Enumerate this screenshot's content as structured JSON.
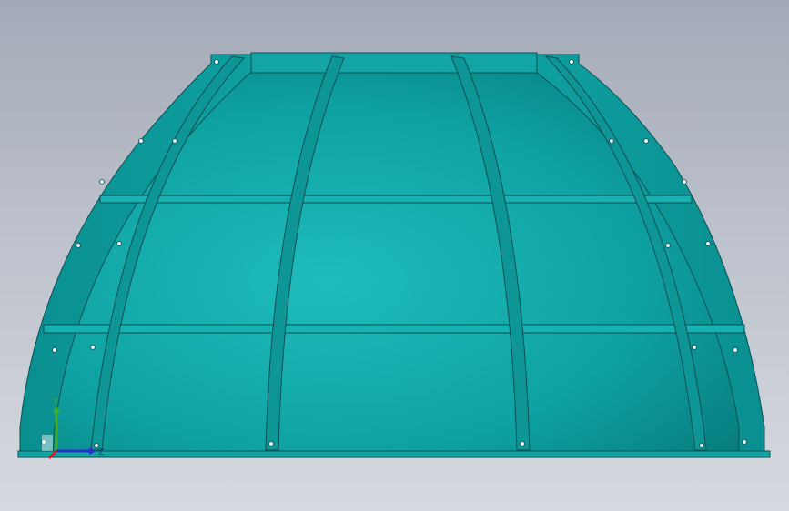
{
  "viewport": {
    "background_top": "#a3a9b6",
    "background_bottom": "#d6d9e0",
    "part_color": "#16a8a8",
    "edge_color": "#0b4f52"
  },
  "triad": {
    "x_label": "",
    "y_label": "Y",
    "z_label": "Z",
    "y_color": "#3fae2e",
    "z_color": "#2433c9",
    "x_color": "#c8212a"
  }
}
